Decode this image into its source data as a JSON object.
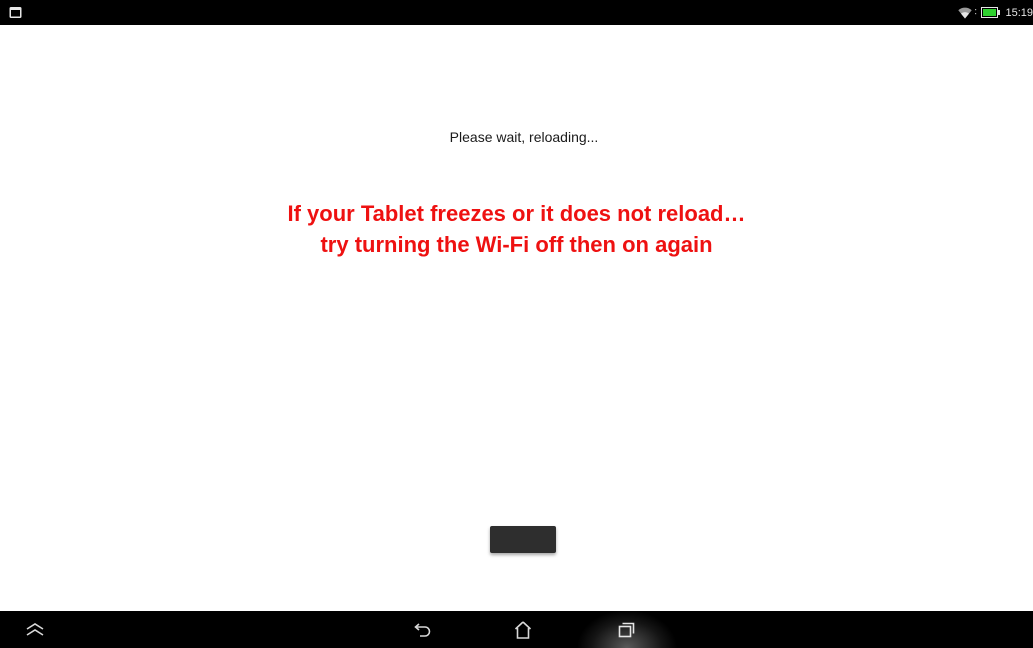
{
  "status_bar": {
    "time": "15:19",
    "icons": [
      "notification-icon",
      "wifi-icon",
      "battery-icon"
    ]
  },
  "main": {
    "wait_message": "Please wait, reloading...",
    "notice_line1": "If your Tablet freezes or it does not reload…",
    "notice_line2": "try turning the Wi-Fi off then on again",
    "notice_color": "#ee1111"
  },
  "nav_bar": {
    "buttons": [
      "menu-expand-icon",
      "back-icon",
      "home-icon",
      "recent-apps-icon"
    ]
  }
}
